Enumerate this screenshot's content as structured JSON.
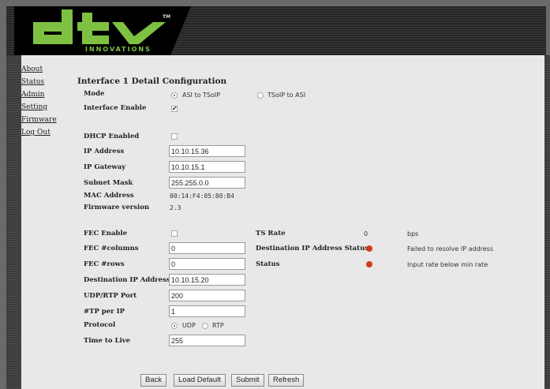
{
  "brand": {
    "tm": "TM",
    "tagline": "INNOVATIONS"
  },
  "nav": [
    "About",
    "Status",
    "Admin",
    "Setting",
    "Firmware",
    "Log Out"
  ],
  "title": "Interface 1 Detail Configuration",
  "mode": {
    "label": "Mode",
    "options": [
      "ASI to TSoIP",
      "TSoIP to ASI"
    ],
    "selected": "ASI to TSoIP"
  },
  "interface_enable": {
    "label": "Interface Enable",
    "checked": true
  },
  "dhcp": {
    "label": "DHCP Enabled",
    "checked": false
  },
  "ip_address": {
    "label": "IP Address",
    "value": "10.10.15.36"
  },
  "ip_gateway": {
    "label": "IP Gateway",
    "value": "10.10.15.1"
  },
  "subnet_mask": {
    "label": "Subnet Mask",
    "value": "255.255.0.0"
  },
  "mac_address": {
    "label": "MAC Address",
    "value": "00:14:F4:05:80:B4"
  },
  "firmware_version": {
    "label": "Firmware version",
    "value": "2.3"
  },
  "fec_enable": {
    "label": "FEC Enable",
    "checked": false
  },
  "fec_columns": {
    "label": "FEC #columns",
    "value": "0"
  },
  "fec_rows": {
    "label": "FEC #rows",
    "value": "0"
  },
  "dest_ip": {
    "label": "Destination IP Address",
    "value": "10.10.15.20"
  },
  "udp_port": {
    "label": "UDP/RTP Port",
    "value": "200"
  },
  "tp_per_ip": {
    "label": "#TP per IP",
    "value": "1"
  },
  "protocol": {
    "label": "Protocol",
    "options": [
      "UDP",
      "RTP"
    ],
    "selected": "UDP"
  },
  "ttl": {
    "label": "Time to Live",
    "value": "255"
  },
  "ts_rate": {
    "label": "TS Rate",
    "value": "0",
    "unit": "bps"
  },
  "dest_status": {
    "label": "Destination IP Address Status",
    "message": "Failed to resolve IP address",
    "color": "#d33a1b"
  },
  "status": {
    "label": "Status",
    "message": "Input rate below min rate",
    "color": "#d33a1b"
  },
  "buttons": {
    "back": "Back",
    "load_default": "Load Default",
    "submit": "Submit",
    "refresh": "Refresh"
  }
}
